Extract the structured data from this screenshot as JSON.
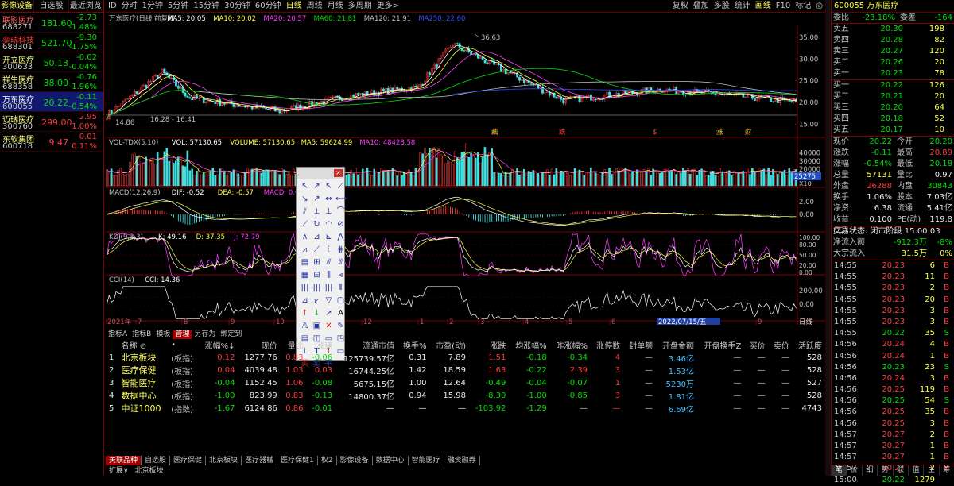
{
  "left_tabs": [
    "影像设备",
    "自选股",
    "最近浏览"
  ],
  "watchlist": [
    {
      "name": "联影医疗",
      "code": "688271",
      "price": "181.60",
      "change": "-2.73",
      "pct": "-1.48%",
      "dir": "down",
      "name_color": "#ff6060"
    },
    {
      "name": "奕瑞科技",
      "code": "688301",
      "price": "521.70",
      "change": "-9.30",
      "pct": "-1.75%",
      "dir": "down",
      "name_color": "#ff3c3c"
    },
    {
      "name": "开立医疗",
      "code": "300633",
      "price": "50.13",
      "change": "-0.02",
      "pct": "-0.04%",
      "dir": "down",
      "name_color": "#ffff80"
    },
    {
      "name": "祥生医疗",
      "code": "688358",
      "price": "38.00",
      "change": "-0.76",
      "pct": "-1.96%",
      "dir": "down",
      "name_color": "#ffff80"
    },
    {
      "name": "万东医疗",
      "code": "600055",
      "price": "20.22",
      "change": "-0.11",
      "pct": "-0.54%",
      "dir": "down",
      "name_color": "#ffffff"
    },
    {
      "name": "迈瑞医疗",
      "code": "300760",
      "price": "299.00",
      "change": "2.95",
      "pct": "1.00%",
      "dir": "up",
      "name_color": "#ffff80"
    },
    {
      "name": "东软集团",
      "code": "600718",
      "price": "9.47",
      "change": "0.01",
      "pct": "0.11%",
      "dir": "up",
      "name_color": "#ffff80"
    }
  ],
  "selected_index": 4,
  "period_tabs": [
    "ID",
    "分时",
    "1分钟",
    "5分钟",
    "15分钟",
    "30分钟",
    "60分钟",
    "日线",
    "周线",
    "月线",
    "多周期",
    "更多>"
  ],
  "active_period": "日线",
  "top_tools": [
    "复权",
    "叠加",
    "多股",
    "统计",
    "画线",
    "F10",
    "标记",
    "◎"
  ],
  "main_title": "万东医疗(日线 前复权)",
  "ma_labels": [
    {
      "text": "MA5: 20.05",
      "color": "#ffffff"
    },
    {
      "text": "MA10: 20.02",
      "color": "#ffff40"
    },
    {
      "text": "MA20: 20.57",
      "color": "#ff40ff"
    },
    {
      "text": "MA60: 21.81",
      "color": "#00e000"
    },
    {
      "text": "MA120: 21.91",
      "color": "#c0c0c0"
    },
    {
      "text": "MA250: 22.60",
      "color": "#3050ff"
    }
  ],
  "price_axis": [
    "35.00",
    "30.00",
    "25.00",
    "20.00",
    "15.00"
  ],
  "peak_label": "36.63",
  "low_label": "14.86",
  "range_label": "16.28 - 16.41",
  "events": [
    "藕",
    "跌",
    "$",
    "涨",
    "财"
  ],
  "vol_title": "VOL-TDX(5,10)",
  "vol_labels": [
    {
      "text": "VOL: 57130.65",
      "color": "#ffffff"
    },
    {
      "text": "VOLUME: 57130.65",
      "color": "#ffff40"
    },
    {
      "text": "MA5: 59624.99",
      "color": "#ffff40"
    },
    {
      "text": "MA10: 48428.58",
      "color": "#ff40ff"
    }
  ],
  "vol_axis": [
    "40000",
    "30000",
    "20000"
  ],
  "vol_tag": "25275",
  "vol_unit": "X10",
  "macd_title": "MACD(12,26,9)",
  "macd_labels": [
    {
      "text": "DIF: -0.52",
      "color": "#ffffff"
    },
    {
      "text": "DEA: -0.57",
      "color": "#ffff40"
    },
    {
      "text": "MACD: 0.09",
      "color": "#ff40ff"
    }
  ],
  "macd_axis": [
    "2.00",
    "0.00"
  ],
  "kdj_title": "KDJ(9,3,3)",
  "kdj_labels": [
    {
      "text": "K: 49.16",
      "color": "#ffffff"
    },
    {
      "text": "D: 37.35",
      "color": "#ffff40"
    },
    {
      "text": "J: 72.79",
      "color": "#ff40ff"
    }
  ],
  "kdj_axis": [
    "100.00",
    "80.00",
    "50.00",
    "20.00",
    "0.00"
  ],
  "cci_title": "CCI(14)",
  "cci_labels": [
    {
      "text": "CCI: 14.36",
      "color": "#ffffff"
    }
  ],
  "cci_axis": [
    "200.00",
    "0.00"
  ],
  "date_axis": [
    "2021年",
    "7",
    "8",
    "9",
    "10",
    "11",
    "12",
    "1",
    "2",
    "3",
    "4",
    "5",
    "6",
    "7",
    "8",
    "9"
  ],
  "cursor_date": "2022/07/15/五",
  "line_tag": "日线",
  "indicator_tabs": [
    "指标A",
    "指标B",
    "模板",
    "管理",
    "另存为",
    "绑定到"
  ],
  "active_indicator_tab": "管理",
  "table": {
    "headers": [
      "",
      "名称 ⊙",
      "•",
      "涨幅%↓",
      "现价",
      "量比",
      "涨速",
      "流通市值",
      "换手%",
      "市盈(动)",
      "涨跌",
      "均涨幅%",
      "昨涨幅%",
      "涨停数",
      "封单额",
      "开盘金额",
      "开盘换手Z",
      "买价",
      "卖价",
      "活跃度"
    ],
    "rows": [
      {
        "cells": [
          "1",
          "北京板块",
          "(板指)",
          "0.12",
          "1277.76",
          "0.83",
          "-0.06",
          "125739.57亿",
          "0.31",
          "7.89",
          "1.51",
          "-0.18",
          "-0.34",
          "4",
          "—",
          "3.46亿",
          "—",
          "—",
          "—",
          "528"
        ]
      },
      {
        "cells": [
          "2",
          "医疗保健",
          "(板指)",
          "0.04",
          "4039.48",
          "1.03",
          "0.03",
          "16744.25亿",
          "1.42",
          "18.59",
          "1.63",
          "-0.22",
          "2.39",
          "3",
          "—",
          "1.53亿",
          "—",
          "—",
          "—",
          "528"
        ]
      },
      {
        "cells": [
          "3",
          "智能医疗",
          "(板指)",
          "-0.04",
          "1152.45",
          "1.06",
          "-0.08",
          "5675.15亿",
          "1.00",
          "12.64",
          "-0.49",
          "-0.04",
          "-0.07",
          "1",
          "—",
          "5230万",
          "—",
          "—",
          "—",
          "527"
        ]
      },
      {
        "cells": [
          "4",
          "数据中心",
          "(板指)",
          "-1.00",
          "823.99",
          "0.83",
          "-0.13",
          "14800.37亿",
          "0.94",
          "15.98",
          "-8.30",
          "-1.00",
          "-0.85",
          "3",
          "—",
          "1.81亿",
          "—",
          "—",
          "—",
          "528"
        ]
      },
      {
        "cells": [
          "5",
          "中证1000",
          "(指数)",
          "-1.67",
          "6124.86",
          "0.86",
          "-0.01",
          "—",
          "—",
          "—",
          "-103.92",
          "-1.29",
          "—",
          "—",
          "—",
          "6.69亿",
          "—",
          "—",
          "—",
          "4743"
        ]
      }
    ]
  },
  "sector_tabs": [
    "关联品种",
    "自选股",
    "医疗保健",
    "北京板块",
    "医疗器械",
    "医疗保健1",
    "权2",
    "影像设备",
    "数据中心",
    "智能医疗",
    "融资融券"
  ],
  "active_sector_tab": "关联品种",
  "ext_bar": [
    "扩展∨",
    "北京板块"
  ],
  "stock_header": "600055 万东医疗",
  "webi": {
    "label": "委比",
    "value": "-23.18%",
    "label2": "委差",
    "value2": "-164"
  },
  "asks": [
    {
      "label": "卖五",
      "price": "20.30",
      "vol": "198"
    },
    {
      "label": "卖四",
      "price": "20.28",
      "vol": "82"
    },
    {
      "label": "卖三",
      "price": "20.27",
      "vol": "120"
    },
    {
      "label": "卖二",
      "price": "20.26",
      "vol": "20"
    },
    {
      "label": "卖一",
      "price": "20.23",
      "vol": "78"
    }
  ],
  "bids": [
    {
      "label": "买一",
      "price": "20.22",
      "vol": "126"
    },
    {
      "label": "买二",
      "price": "20.21",
      "vol": "20"
    },
    {
      "label": "买三",
      "price": "20.20",
      "vol": "64"
    },
    {
      "label": "买四",
      "price": "20.18",
      "vol": "52"
    },
    {
      "label": "买五",
      "price": "20.17",
      "vol": "10"
    }
  ],
  "stats": [
    {
      "l1": "现价",
      "v1": "20.22",
      "c1": "#00e000",
      "l2": "今开",
      "v2": "20.20",
      "c2": "#00e000"
    },
    {
      "l1": "涨跌",
      "v1": "-0.11",
      "c1": "#00e000",
      "l2": "最高",
      "v2": "20.89",
      "c2": "#ff3c3c"
    },
    {
      "l1": "涨幅",
      "v1": "-0.54%",
      "c1": "#00e000",
      "l2": "最低",
      "v2": "20.18",
      "c2": "#00e000"
    },
    {
      "l1": "总量",
      "v1": "57131",
      "c1": "#ffff40",
      "l2": "量比",
      "v2": "0.97",
      "c2": "#e8e8e8"
    },
    {
      "l1": "外盘",
      "v1": "26288",
      "c1": "#ff3c3c",
      "l2": "内盘",
      "v2": "30843",
      "c2": "#00e000"
    },
    {
      "l1": "换手",
      "v1": "1.06%",
      "c1": "#e8e8e8",
      "l2": "股本",
      "v2": "7.03亿",
      "c2": "#e8e8e8"
    },
    {
      "l1": "净资",
      "v1": "6.38",
      "c1": "#e8e8e8",
      "l2": "流通",
      "v2": "5.41亿",
      "c2": "#e8e8e8"
    },
    {
      "l1": "收益(二)",
      "v1": "0.100",
      "c1": "#e8e8e8",
      "l2": "PE(动)",
      "v2": "119.8",
      "c2": "#e8e8e8"
    }
  ],
  "trade_status": "交易状态: 闭市阶段 15:00:03",
  "flows": [
    {
      "label": "净流入额",
      "value": "-912.3万",
      "pct": "-8%",
      "color": "#00e000"
    },
    {
      "label": "大宗流入",
      "value": "31.5万",
      "pct": "0%",
      "color": "#ffff40"
    }
  ],
  "ticks": [
    {
      "t": "14:55",
      "p": "20.23",
      "v": "6",
      "s": "B"
    },
    {
      "t": "14:55",
      "p": "20.23",
      "v": "11",
      "s": "B"
    },
    {
      "t": "14:55",
      "p": "20.23",
      "v": "2",
      "s": "B"
    },
    {
      "t": "14:55",
      "p": "20.23",
      "v": "20",
      "s": "B"
    },
    {
      "t": "14:55",
      "p": "20.23",
      "v": "3",
      "s": "B"
    },
    {
      "t": "14:55",
      "p": "20.23",
      "v": "3",
      "s": "B"
    },
    {
      "t": "14:55",
      "p": "20.22",
      "v": "35",
      "s": "S"
    },
    {
      "t": "14:56",
      "p": "20.24",
      "v": "4",
      "s": "B"
    },
    {
      "t": "14:56",
      "p": "20.24",
      "v": "1",
      "s": "B"
    },
    {
      "t": "14:56",
      "p": "20.23",
      "v": "23",
      "s": "S"
    },
    {
      "t": "14:56",
      "p": "20.24",
      "v": "3",
      "s": "B"
    },
    {
      "t": "14:56",
      "p": "20.25",
      "v": "119",
      "s": "B"
    },
    {
      "t": "14:56",
      "p": "20.25",
      "v": "54",
      "s": "S"
    },
    {
      "t": "14:56",
      "p": "20.25",
      "v": "35",
      "s": "B"
    },
    {
      "t": "14:56",
      "p": "20.25",
      "v": "3",
      "s": "B"
    },
    {
      "t": "14:57",
      "p": "20.27",
      "v": "2",
      "s": "B"
    },
    {
      "t": "14:57",
      "p": "20.27",
      "v": "1",
      "s": "B"
    },
    {
      "t": "14:57",
      "p": "20.27",
      "v": "1",
      "s": "B"
    },
    {
      "t": "14:57",
      "p": "20.27",
      "v": "2",
      "s": "B"
    },
    {
      "t": "15:00",
      "p": "20.22",
      "v": "1279",
      "s": ""
    }
  ],
  "right_tabs": [
    "笔",
    "价",
    "细",
    "势",
    "联",
    "值",
    "主",
    "筹"
  ],
  "active_right_tab": "笔"
}
